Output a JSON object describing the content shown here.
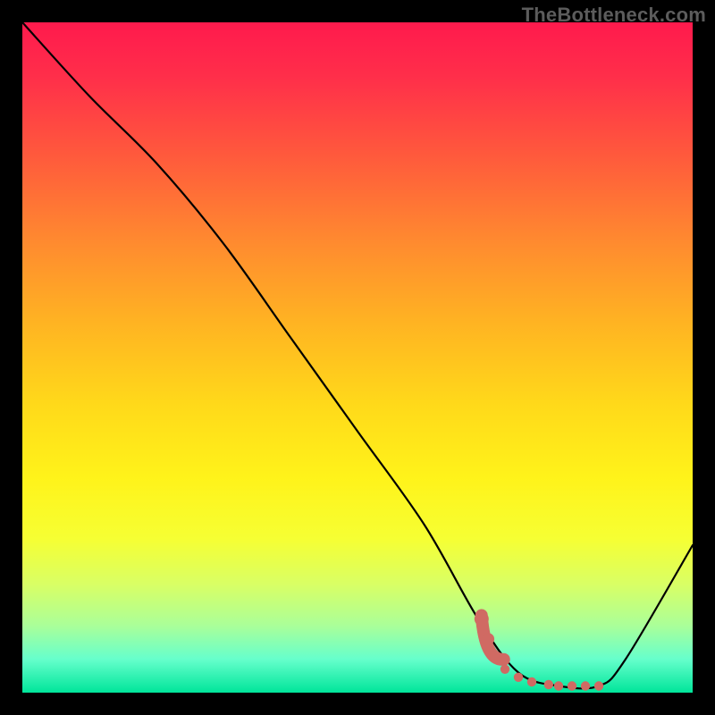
{
  "attribution": "TheBottleneck.com",
  "chart_data": {
    "type": "line",
    "title": "",
    "xlabel": "",
    "ylabel": "",
    "xlim": [
      0,
      100
    ],
    "ylim": [
      0,
      100
    ],
    "series": [
      {
        "name": "bottleneck-curve",
        "x": [
          0,
          10,
          20,
          30,
          40,
          50,
          60,
          68,
          74,
          80,
          86,
          90,
          100
        ],
        "y": [
          100,
          89,
          79,
          67,
          53,
          39,
          25,
          11,
          3,
          1,
          1,
          5,
          22
        ]
      }
    ],
    "annotations": [
      {
        "name": "valley-marker",
        "points_x": [
          68.5,
          69.5,
          70.5,
          72,
          74,
          76,
          78.5,
          80,
          82,
          84,
          86
        ],
        "points_y": [
          11,
          8,
          5.5,
          3.5,
          2.3,
          1.6,
          1.2,
          1.0,
          1.0,
          1.0,
          1.0
        ],
        "style": "dots",
        "color": "#d06a63"
      }
    ],
    "background": {
      "type": "vertical-gradient",
      "top_color": "#ff1a4d",
      "bottom_color": "#00e59a"
    }
  }
}
